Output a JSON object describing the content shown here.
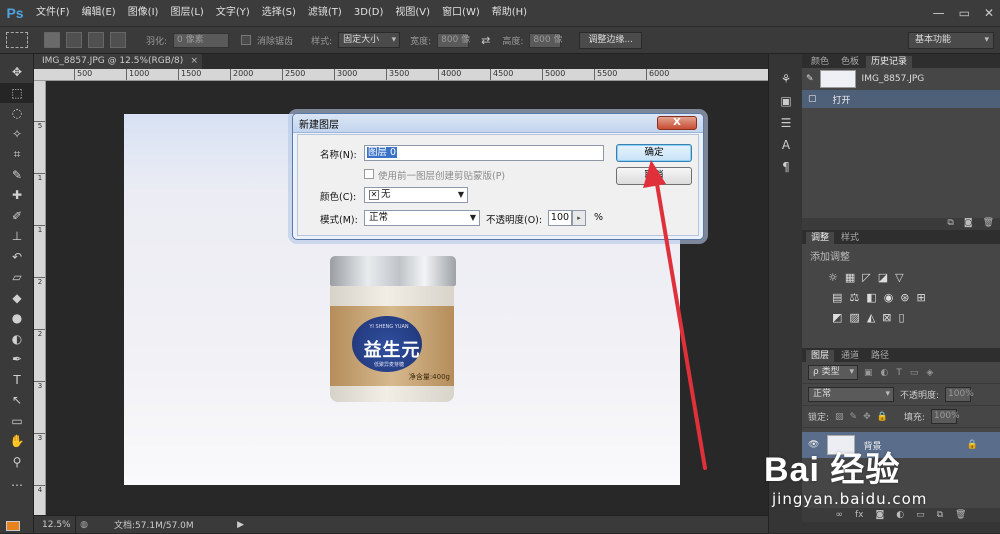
{
  "app": {
    "logo": "Ps"
  },
  "menu": [
    "文件(F)",
    "编辑(E)",
    "图像(I)",
    "图层(L)",
    "文字(Y)",
    "选择(S)",
    "滤镜(T)",
    "3D(D)",
    "视图(V)",
    "窗口(W)",
    "帮助(H)"
  ],
  "window_controls": {
    "minimize": "—",
    "restore": "▭",
    "close": "✕"
  },
  "options": {
    "feather_label": "羽化:",
    "feather_value": "0 像素",
    "antialias_label": "消除锯齿",
    "style_label": "样式:",
    "style_value": "固定大小",
    "width_label": "宽度:",
    "width_value": "800 像",
    "height_label": "高度:",
    "height_value": "800 像",
    "refine_edge": "调整边缘...",
    "workspace": "基本功能"
  },
  "document": {
    "tab_title": "IMG_8857.JPG @ 12.5%(RGB/8)",
    "tab_close": "×",
    "ruler_h": [
      "500",
      "1000",
      "1500",
      "2000",
      "2500",
      "3000",
      "3500",
      "4000",
      "4500",
      "5000",
      "5500",
      "6000"
    ],
    "ruler_v": [
      "5",
      "1",
      "1",
      "2",
      "2",
      "3",
      "3",
      "4"
    ]
  },
  "product": {
    "title": "益生元",
    "sub_en": "YI SHENG YUAN",
    "sub_cn": "低聚异麦芽糖",
    "weight": "净含量:400g"
  },
  "status": {
    "zoom": "12.5%",
    "doc_size": "文档:57.1M/57.0M"
  },
  "panels": {
    "history_tabs": [
      "颜色",
      "色板",
      "历史记录"
    ],
    "history_snapshot": "IMG_8857.JPG",
    "history_step": "打开",
    "adjust_tabs": [
      "调整",
      "样式"
    ],
    "adjust_title": "添加调整",
    "layers_tabs": [
      "图层",
      "通道",
      "路径"
    ],
    "layer_filter": "ρ 类型",
    "blend_mode": "正常",
    "opacity_label": "不透明度:",
    "opacity_value": "100%",
    "lock_label": "锁定:",
    "fill_label": "填充:",
    "fill_value": "100%",
    "background_layer": "背景"
  },
  "dialog": {
    "title": "新建图层",
    "close": "X",
    "name_label": "名称(N):",
    "name_value": "图层 0",
    "clip_label": "使用前一图层创建剪贴蒙版(P)",
    "color_label": "颜色(C):",
    "color_value": "无",
    "mode_label": "模式(M):",
    "mode_value": "正常",
    "opacity_label": "不透明度(O):",
    "opacity_value": "100",
    "percent": "%",
    "ok": "确定",
    "cancel": "取消"
  },
  "watermark": {
    "brand": "Bai 经验",
    "url": "jingyan.baidu.com"
  },
  "colors": {
    "accent": "#e0303a",
    "foreground": "#e8821e",
    "selection": "#3a72c8"
  }
}
